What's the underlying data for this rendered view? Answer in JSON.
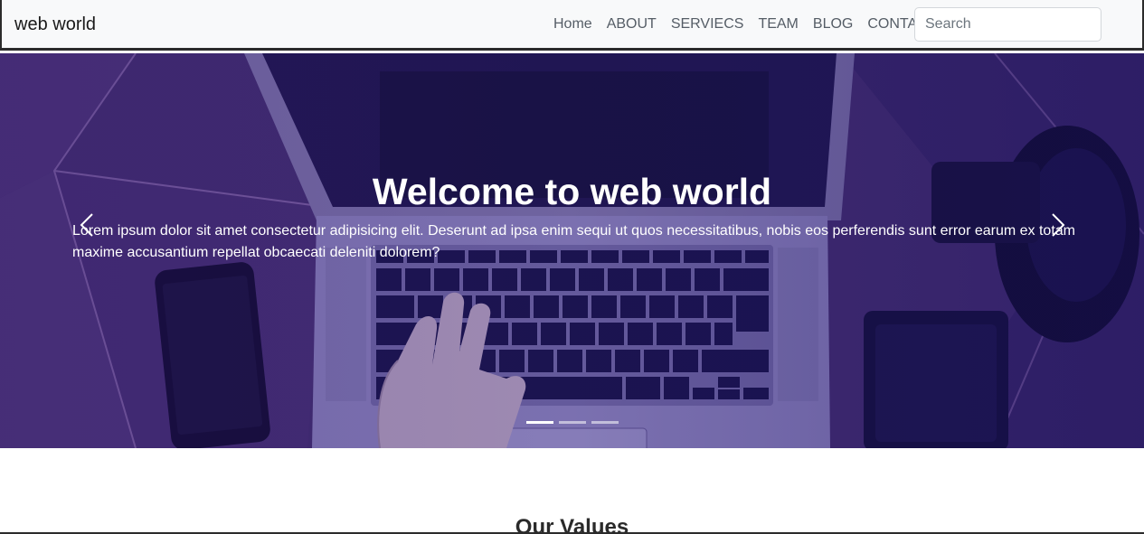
{
  "navbar": {
    "brand": "web world",
    "links": [
      "Home",
      "ABOUT",
      "SERVIECS",
      "TEAM",
      "BLOG",
      "CONTACT"
    ],
    "search_placeholder": "Search"
  },
  "hero": {
    "title": "Welcome to web world",
    "text": "Lorem ipsum dolor sit amet consectetur adipisicing elit. Deserunt ad ipsa enim sequi ut quos necessitatibus, nobis eos perferendis sunt error earum ex totam maxime accusantium repellat obcaecati deleniti dolorem?",
    "prev_icon": "chevron-left-icon",
    "next_icon": "chevron-right-icon",
    "slide_count": 3,
    "active_slide": 1
  },
  "section": {
    "title": "Our Values"
  },
  "colors": {
    "navbar_bg": "#f8f9fa",
    "hero_overlay": "#2a1a78",
    "text_white": "#ffffff"
  }
}
